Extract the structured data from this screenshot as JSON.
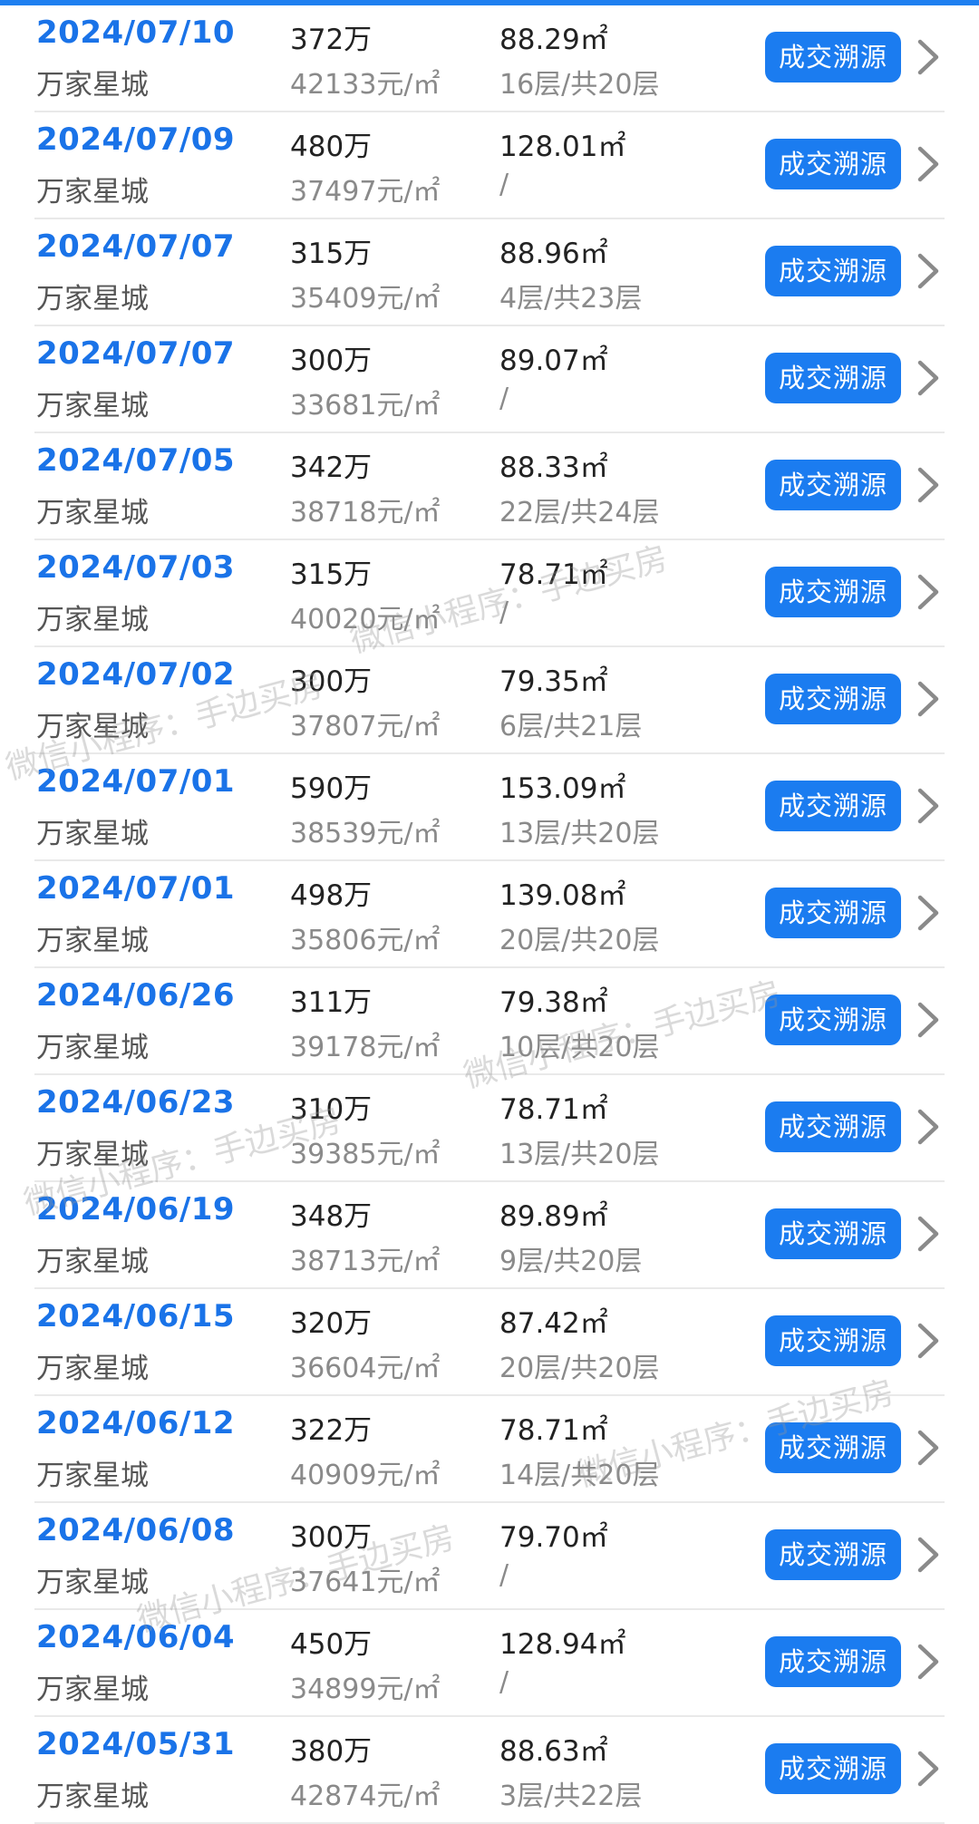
{
  "accent_color": "#1b7cf0",
  "button_label": "成交溯源",
  "chevron_icon": "chevron-right-icon",
  "records": [
    {
      "date": "2024/07/10",
      "community": "万家星城",
      "total_price": "372万",
      "unit_price": "42133元/㎡",
      "area": "88.29㎡",
      "floor": "16层/共20层"
    },
    {
      "date": "2024/07/09",
      "community": "万家星城",
      "total_price": "480万",
      "unit_price": "37497元/㎡",
      "area": "128.01㎡",
      "floor": "/"
    },
    {
      "date": "2024/07/07",
      "community": "万家星城",
      "total_price": "315万",
      "unit_price": "35409元/㎡",
      "area": "88.96㎡",
      "floor": "4层/共23层"
    },
    {
      "date": "2024/07/07",
      "community": "万家星城",
      "total_price": "300万",
      "unit_price": "33681元/㎡",
      "area": "89.07㎡",
      "floor": "/"
    },
    {
      "date": "2024/07/05",
      "community": "万家星城",
      "total_price": "342万",
      "unit_price": "38718元/㎡",
      "area": "88.33㎡",
      "floor": "22层/共24层"
    },
    {
      "date": "2024/07/03",
      "community": "万家星城",
      "total_price": "315万",
      "unit_price": "40020元/㎡",
      "area": "78.71㎡",
      "floor": "/"
    },
    {
      "date": "2024/07/02",
      "community": "万家星城",
      "total_price": "300万",
      "unit_price": "37807元/㎡",
      "area": "79.35㎡",
      "floor": "6层/共21层"
    },
    {
      "date": "2024/07/01",
      "community": "万家星城",
      "total_price": "590万",
      "unit_price": "38539元/㎡",
      "area": "153.09㎡",
      "floor": "13层/共20层"
    },
    {
      "date": "2024/07/01",
      "community": "万家星城",
      "total_price": "498万",
      "unit_price": "35806元/㎡",
      "area": "139.08㎡",
      "floor": "20层/共20层"
    },
    {
      "date": "2024/06/26",
      "community": "万家星城",
      "total_price": "311万",
      "unit_price": "39178元/㎡",
      "area": "79.38㎡",
      "floor": "10层/共20层"
    },
    {
      "date": "2024/06/23",
      "community": "万家星城",
      "total_price": "310万",
      "unit_price": "39385元/㎡",
      "area": "78.71㎡",
      "floor": "13层/共20层"
    },
    {
      "date": "2024/06/19",
      "community": "万家星城",
      "total_price": "348万",
      "unit_price": "38713元/㎡",
      "area": "89.89㎡",
      "floor": "9层/共20层"
    },
    {
      "date": "2024/06/15",
      "community": "万家星城",
      "total_price": "320万",
      "unit_price": "36604元/㎡",
      "area": "87.42㎡",
      "floor": "20层/共20层"
    },
    {
      "date": "2024/06/12",
      "community": "万家星城",
      "total_price": "322万",
      "unit_price": "40909元/㎡",
      "area": "78.71㎡",
      "floor": "14层/共20层"
    },
    {
      "date": "2024/06/08",
      "community": "万家星城",
      "total_price": "300万",
      "unit_price": "37641元/㎡",
      "area": "79.70㎡",
      "floor": "/"
    },
    {
      "date": "2024/06/04",
      "community": "万家星城",
      "total_price": "450万",
      "unit_price": "34899元/㎡",
      "area": "128.94㎡",
      "floor": "/"
    },
    {
      "date": "2024/05/31",
      "community": "万家星城",
      "total_price": "380万",
      "unit_price": "42874元/㎡",
      "area": "88.63㎡",
      "floor": "3层/共22层"
    }
  ],
  "watermark_text": "微信小程序：手边买房"
}
